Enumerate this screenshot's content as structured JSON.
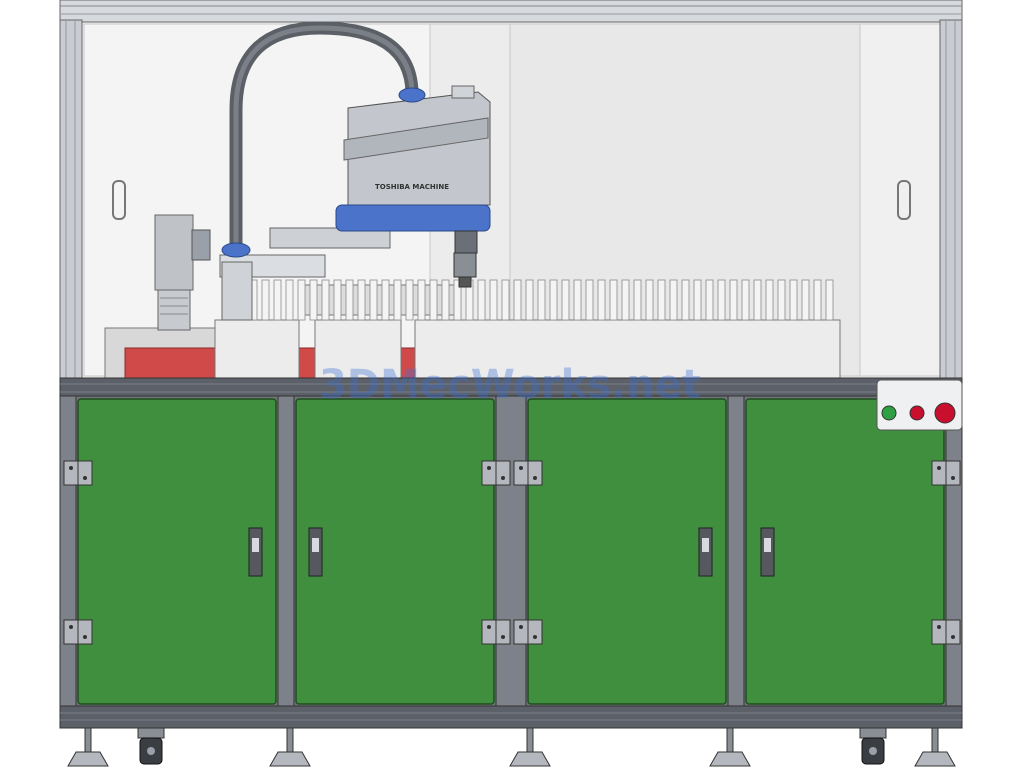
{
  "robot": {
    "brand_label": "TOSHIBA MACHINE"
  },
  "watermark": {
    "text": "3DMecWorks.net"
  },
  "panel": {
    "lamps": [
      {
        "name": "green-indicator-lamp",
        "color": "#2ea043"
      },
      {
        "name": "red-indicator-lamp",
        "color": "#c8102e"
      },
      {
        "name": "red-stop-button",
        "color": "#c8102e"
      }
    ]
  },
  "colors": {
    "door_green": "#3f8f3f",
    "frame_gray": "#9aa0aa",
    "robot_blue": "#4a73c9",
    "conveyor_red": "#d14a4a"
  }
}
